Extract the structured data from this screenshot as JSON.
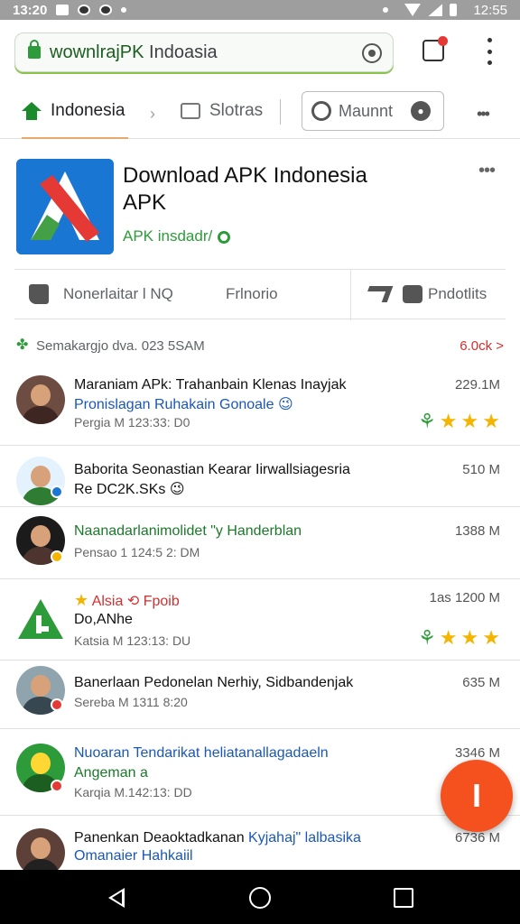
{
  "status_bar": {
    "time": "13:20",
    "right_time": "12:55"
  },
  "browser": {
    "url_bold": "wownlrajPK",
    "url_rest": " Indoasia"
  },
  "nav": {
    "home_label": "Indonesia",
    "stores_label": "Slotras",
    "pill_label": "Maunnt",
    "more_icon": "more-horiz-icon"
  },
  "app": {
    "title": "Download APK Indonesia APK",
    "subtitle": "APK insdadr/",
    "colors": {
      "blue": "#1976d2",
      "red": "#e53935",
      "green": "#43a047",
      "accent": "#2e9b3b"
    }
  },
  "actions": {
    "left": "Nonerlaitar l NQ",
    "middle": "Frlnorio",
    "right": "Pndotlits"
  },
  "list_header": {
    "label": "Semakargjo dva. 023 5SAM",
    "right": "6.0ck >"
  },
  "messages": [
    {
      "line1": "Maraniam APk: Trahanbain Klenas Inayjak",
      "line2": "Pronislagan Ruhakain Gonoale",
      "emoji": "😉",
      "meta": "Pergia M 123:33: D0",
      "size": "229.1M",
      "stars": 3
    },
    {
      "line1": "Baborita Seonastian Kearar",
      "line1b": " Iirwallsiagesria",
      "line2": "Re DC2K.SKs",
      "emoji": "😉",
      "meta": "",
      "size": "510 M"
    },
    {
      "line1": "Naanadarlanimolidet \"y Handerblan",
      "line2": "",
      "meta": "Pensao 1 124:5 2: DM",
      "size": "1388 M"
    },
    {
      "line1": "Alsia",
      "line1b": "Fpoib",
      "line2": "Do,ANhe",
      "meta": "Katsia M 123:13: DU",
      "size": "1as 1200 M",
      "stars": 3
    },
    {
      "line1": "Banerlaan Pedonelan Nerhiy, Sidbandenjak",
      "line2": "",
      "meta": "Sereba M 1311 8:20",
      "size": "635 M"
    },
    {
      "line1": "Nuoaran Tendarikat heliatanallagadaeln",
      "line2": "Angeman a",
      "meta": "Karqia M.142:13: DD",
      "size": "3346 M"
    },
    {
      "line1": "Panenkan Deaoktadkanan",
      "line1b": " Kyjahaj\" lalbasika",
      "line2": "Omanaier Hahkaiil",
      "meta": "",
      "size": "6736 M"
    }
  ],
  "fab_icon": "compose-icon",
  "fab_glyph": "I"
}
